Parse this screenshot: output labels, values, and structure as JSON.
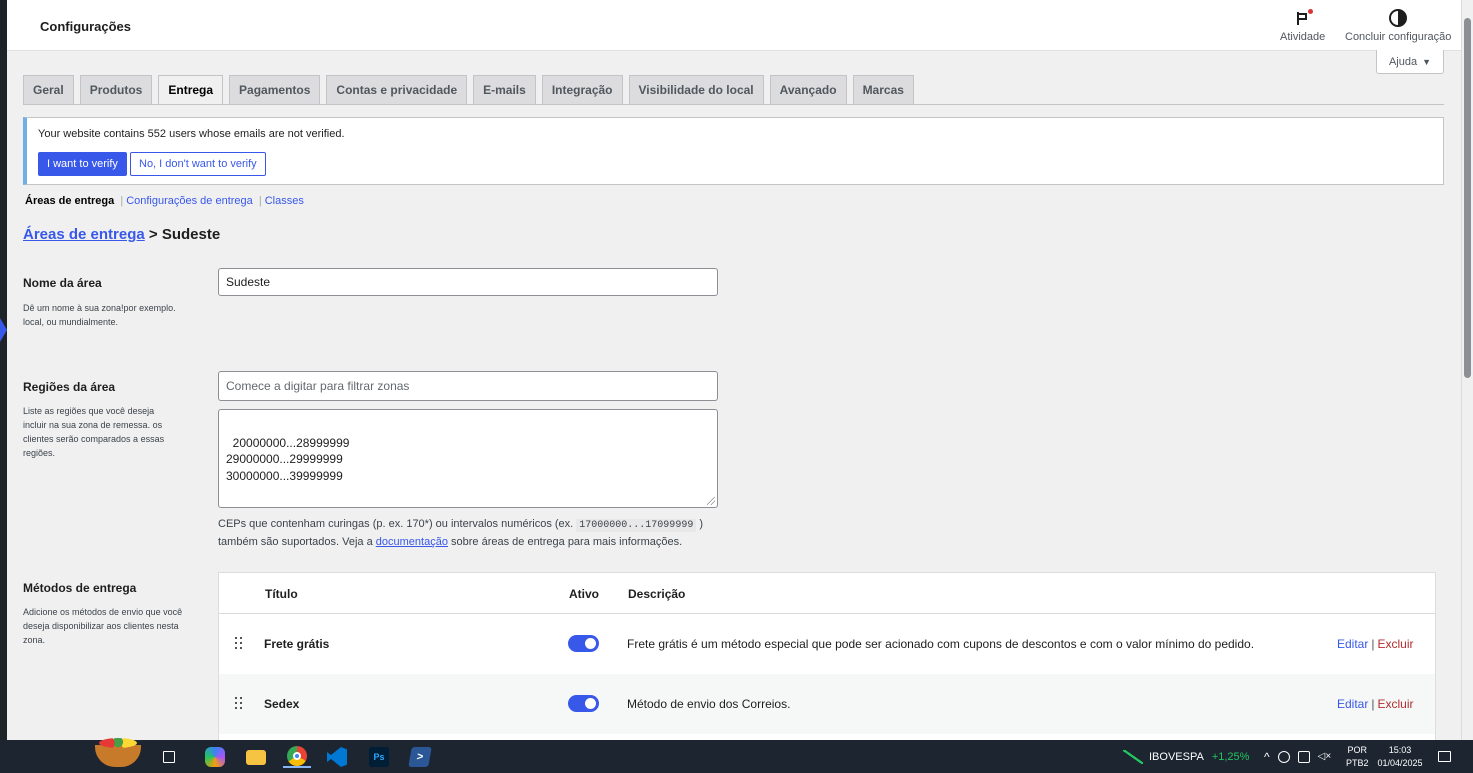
{
  "topbar": {
    "title": "Configurações",
    "activity_label": "Atividade",
    "finish_label": "Concluir configuração",
    "help_label": "Ajuda"
  },
  "tabs": [
    {
      "label": "Geral"
    },
    {
      "label": "Produtos"
    },
    {
      "label": "Entrega",
      "active": true
    },
    {
      "label": "Pagamentos"
    },
    {
      "label": "Contas e privacidade"
    },
    {
      "label": "E-mails"
    },
    {
      "label": "Integração"
    },
    {
      "label": "Visibilidade do local"
    },
    {
      "label": "Avançado"
    },
    {
      "label": "Marcas"
    }
  ],
  "notice": {
    "text": "Your website contains 552 users whose emails are not verified.",
    "primary_label": "I want to verify",
    "secondary_label": "No, I don't want to verify"
  },
  "subnav": {
    "current": "Áreas de entrega",
    "link1": "Configurações de entrega",
    "link2": "Classes"
  },
  "heading": {
    "link": "Áreas de entrega",
    "separator": " > ",
    "current": "Sudeste"
  },
  "zone_name": {
    "label": "Nome da área",
    "description": "Dê um nome à sua zona!por exemplo. local, ou mundialmente.",
    "value": "Sudeste"
  },
  "zone_regions": {
    "label": "Regiões da área",
    "description": "Liste as regiões que você deseja incluir na sua zona de remessa. os clientes serão comparados a essas regiões.",
    "placeholder": "Comece a digitar para filtrar zonas",
    "postcodes": "20000000...28999999\n29000000...29999999\n30000000...39999999",
    "help_pre": "CEPs que contenham curingas (p. ex. 170*) ou intervalos numéricos (ex.",
    "help_code": "17000000...17099999",
    "help_post": ")",
    "help_line2_pre": "também são suportados. Veja a",
    "help_link": "documentação",
    "help_line2_post": "sobre áreas de entrega para mais informações."
  },
  "methods": {
    "label": "Métodos de entrega",
    "description": "Adicione os métodos de envio que você deseja disponibilizar aos clientes nesta zona.",
    "col_title": "Título",
    "col_active": "Ativo",
    "col_desc": "Descrição",
    "edit_label": "Editar",
    "delete_label": "Excluir",
    "rows": [
      {
        "title": "Frete grátis",
        "enabled": true,
        "description": "Frete grátis é um método especial que pode ser acionado com cupons de descontos e com o valor mínimo do pedido."
      },
      {
        "title": "Sedex",
        "enabled": true,
        "description": "Método de envio dos Correios."
      }
    ]
  },
  "taskbar": {
    "stock_name": "IBOVESPA",
    "stock_change": "+1,25%",
    "lang_top": "POR",
    "lang_bottom": "PTB2",
    "time": "15:03",
    "date": "01/04/2025",
    "stock_color": "#22c55e"
  },
  "colors": {
    "accent": "#3858e9",
    "danger": "#b32d2e"
  }
}
